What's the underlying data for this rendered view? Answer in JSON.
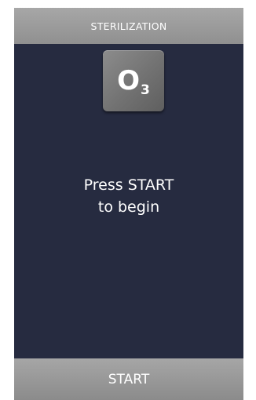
{
  "header": {
    "title": "STERILIZATION"
  },
  "mode_icon": {
    "name": "ozone-o3-icon",
    "letter": "O",
    "subscript": "3"
  },
  "message": {
    "line1": "Press START",
    "line2": "to begin"
  },
  "footer": {
    "start_label": "START"
  },
  "colors": {
    "screen_background": "#262b40",
    "bar_background": "#9a9a9a",
    "icon_tile": "#7a7a7a",
    "text": "#ffffff"
  }
}
